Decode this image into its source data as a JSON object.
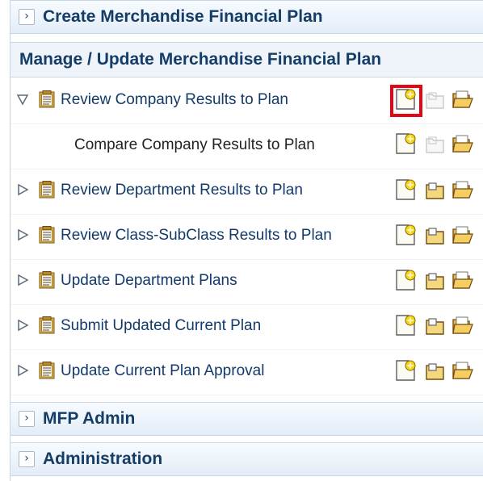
{
  "panels": {
    "create": {
      "label": "Create Merchandise Financial Plan",
      "state": "collapsed"
    },
    "mfp_admin": {
      "label": "MFP Admin",
      "state": "collapsed"
    },
    "administration": {
      "label": "Administration",
      "state": "collapsed"
    }
  },
  "manage_section": {
    "title": "Manage / Update Merchandise Financial Plan",
    "tasks": [
      {
        "label": "Review Company Results to Plan",
        "level": 1,
        "expanded": true,
        "new_action_highlighted": true,
        "open_action_enabled": false
      },
      {
        "label": "Compare Company Results to Plan",
        "level": 2,
        "open_action_enabled": false
      },
      {
        "label": "Review Department Results to Plan",
        "level": 1,
        "expanded": false,
        "open_action_enabled": true
      },
      {
        "label": "Review Class-SubClass Results to Plan",
        "level": 1,
        "expanded": false,
        "open_action_enabled": true
      },
      {
        "label": "Update Department Plans",
        "level": 1,
        "expanded": false,
        "open_action_enabled": true
      },
      {
        "label": "Submit Updated Current Plan",
        "level": 1,
        "expanded": false,
        "open_action_enabled": true
      },
      {
        "label": "Update Current Plan Approval",
        "level": 1,
        "expanded": false,
        "open_action_enabled": true
      }
    ]
  },
  "icons": {
    "collapsed_arrow": "chevron-right-icon",
    "expanded_arrow": "triangle-down-icon",
    "task": "task-list-icon",
    "new": "new-document-icon",
    "open": "open-document-icon",
    "folder": "open-folder-icon"
  },
  "colors": {
    "highlight": "#e30613",
    "header_text": "#153d66",
    "task_link": "#133a6b"
  }
}
